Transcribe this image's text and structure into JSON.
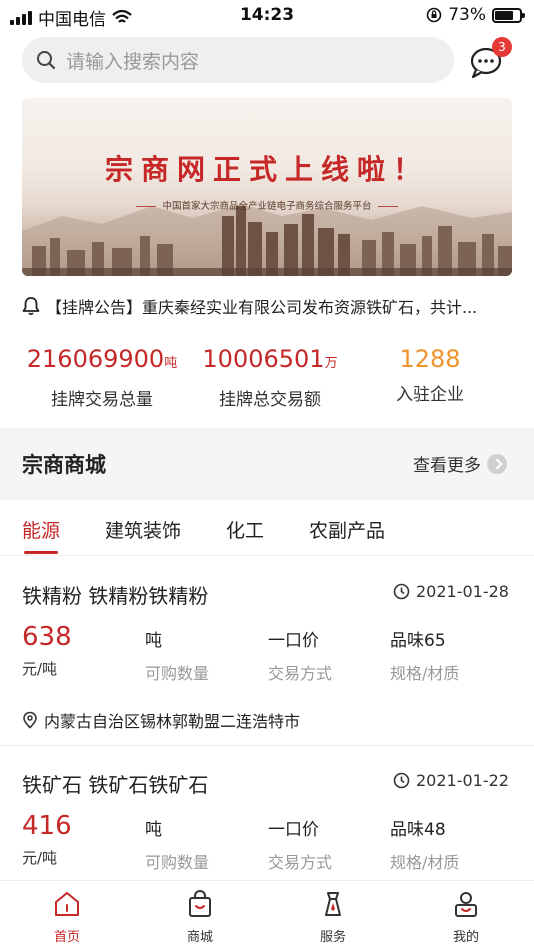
{
  "status_bar": {
    "carrier": "中国电信",
    "time": "14:23",
    "battery": "73%",
    "battery_level": 0.73
  },
  "search": {
    "placeholder": "请输入搜索内容",
    "message_badge": "3"
  },
  "banner": {
    "title": "宗商网正式上线啦！",
    "subtitle": "中国首家大宗商品全产业链电子商务综合服务平台"
  },
  "notice": {
    "text": "【挂牌公告】重庆秦经实业有限公司发布资源铁矿石，共计..."
  },
  "stats": [
    {
      "value": "216069900",
      "unit": "吨",
      "label": "挂牌交易总量",
      "color": "#c62828"
    },
    {
      "value": "10006501",
      "unit": "万",
      "label": "挂牌总交易额",
      "color": "#c62828"
    },
    {
      "value": "1288",
      "unit": "",
      "label": "入驻企业",
      "color": "#f0932b"
    }
  ],
  "mall": {
    "title": "宗商商城",
    "more": "查看更多"
  },
  "tabs": [
    {
      "label": "能源",
      "active": true
    },
    {
      "label": "建筑装饰",
      "active": false
    },
    {
      "label": "化工",
      "active": false
    },
    {
      "label": "农副产品",
      "active": false
    }
  ],
  "products": [
    {
      "title": "铁精粉 铁精粉铁精粉",
      "date": "2021-01-28",
      "price": "638",
      "price_unit": "元/吨",
      "quantity": "吨",
      "quantity_label": "可购数量",
      "trade": "一口价",
      "trade_label": "交易方式",
      "spec": "品味65",
      "spec_label": "规格/材质",
      "location": "内蒙古自治区锡林郭勒盟二连浩特市"
    },
    {
      "title": "铁矿石 铁矿石铁矿石",
      "date": "2021-01-22",
      "price": "416",
      "price_unit": "元/吨",
      "quantity": "吨",
      "quantity_label": "可购数量",
      "trade": "一口价",
      "trade_label": "交易方式",
      "spec": "品味48",
      "spec_label": "规格/材质"
    }
  ],
  "bottom_nav": [
    {
      "label": "首页",
      "icon": "home-icon",
      "active": true
    },
    {
      "label": "商城",
      "icon": "shopping-bag-icon",
      "active": false
    },
    {
      "label": "服务",
      "icon": "service-icon",
      "active": false
    },
    {
      "label": "我的",
      "icon": "profile-icon",
      "active": false
    }
  ],
  "colors": {
    "accent": "#c62828",
    "orange": "#f0932b",
    "muted": "#999999"
  }
}
